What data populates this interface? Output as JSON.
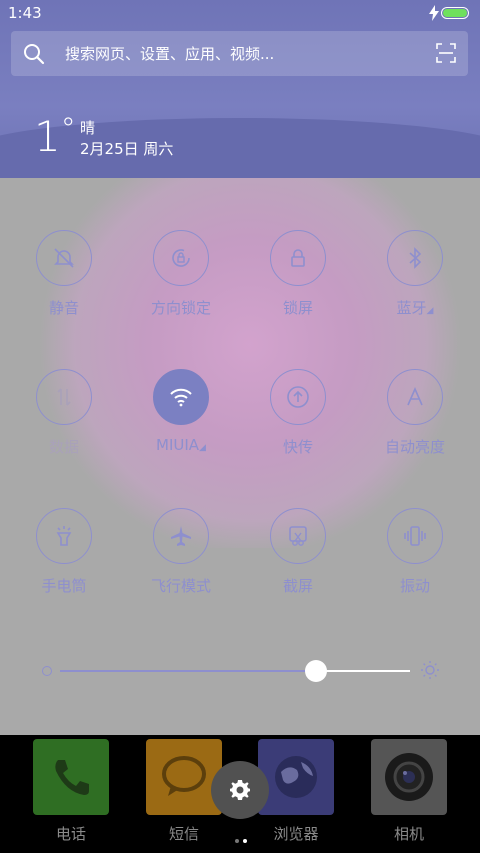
{
  "status_bar": {
    "time": "1:43"
  },
  "search": {
    "placeholder": "搜索网页、设置、应用、视频..."
  },
  "weather": {
    "temperature": "1",
    "degree": "°",
    "condition": "晴",
    "date": "2月25日 周六"
  },
  "toggles": [
    {
      "label": "静音",
      "icon": "bell-off-icon",
      "state": "off"
    },
    {
      "label": "方向锁定",
      "icon": "rotation-lock-icon",
      "state": "off"
    },
    {
      "label": "锁屏",
      "icon": "lock-icon",
      "state": "off"
    },
    {
      "label": "蓝牙",
      "icon": "bluetooth-icon",
      "state": "off",
      "has_more": true
    },
    {
      "label": "数据",
      "icon": "mobile-data-icon",
      "state": "disabled"
    },
    {
      "label": "MIUIA",
      "icon": "wifi-icon",
      "state": "on",
      "has_more": true
    },
    {
      "label": "快传",
      "icon": "upload-icon",
      "state": "off"
    },
    {
      "label": "自动亮度",
      "icon": "auto-brightness-icon",
      "state": "off"
    },
    {
      "label": "手电筒",
      "icon": "flashlight-icon",
      "state": "off"
    },
    {
      "label": "飞行模式",
      "icon": "airplane-icon",
      "state": "off"
    },
    {
      "label": "截屏",
      "icon": "screenshot-icon",
      "state": "off"
    },
    {
      "label": "振动",
      "icon": "vibrate-icon",
      "state": "off"
    }
  ],
  "brightness": {
    "level": 0.73
  },
  "dock": {
    "apps": [
      {
        "label": "电话",
        "icon": "phone-icon",
        "color": "#2f6e23"
      },
      {
        "label": "短信",
        "icon": "message-icon",
        "color": "#9b6a14"
      },
      {
        "label": "浏览器",
        "icon": "browser-icon",
        "color": "#3b3c77"
      },
      {
        "label": "相机",
        "icon": "camera-icon",
        "color": "#555555"
      }
    ],
    "settings_icon": "gear-icon"
  },
  "colors": {
    "accent": "#8e8fce",
    "header": "#7378ba",
    "panel": "#a9a9a9",
    "battery": "#6fe05d"
  }
}
